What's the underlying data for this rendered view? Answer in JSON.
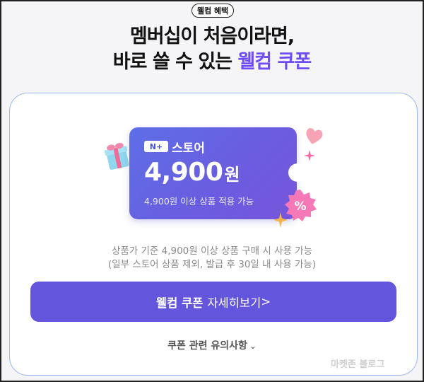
{
  "badge": "웰컴 혜택",
  "headline": {
    "line1": "멤버십이 처음이라면,",
    "line2_prefix": "바로 쓸 수 있는 ",
    "line2_accent": "웰컴 쿠폰"
  },
  "coupon": {
    "brand_mark": "N+",
    "store_label": "스토어",
    "amount": "4,900",
    "unit": "원",
    "condition": "4,900원 이상 상품 적용 가능",
    "percent_symbol": "%"
  },
  "description": {
    "line1": "상품가 기준 4,900원 이상 상품 구매 시 사용 가능",
    "line2": "(일부 스토어 상품 제외, 발급 후 30일 내 사용 가능)"
  },
  "cta": {
    "bold": "웰컴 쿠폰",
    "rest": "자세히보기",
    "arrow": ">"
  },
  "notice": {
    "label": "쿠폰 관련 유의사항",
    "chevron": "⌄"
  },
  "watermark": "마켓존 블로그",
  "colors": {
    "accent": "#6f4cf5",
    "button": "#6356dc",
    "ticket": "#5d6fe6"
  }
}
